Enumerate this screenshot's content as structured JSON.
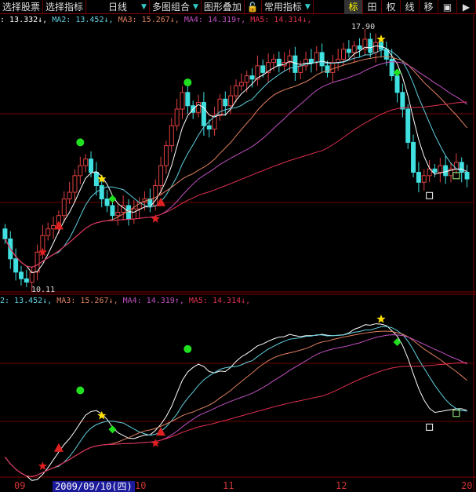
{
  "toolbar": {
    "items": [
      "选择股票",
      "选择指标",
      "日线",
      "多图组合",
      "图形叠加",
      "常用指标"
    ],
    "right_buttons": [
      "标",
      "田",
      "权",
      "线",
      "移",
      "▣",
      "▶"
    ],
    "lock_icon": "lock-icon"
  },
  "upper_legend": {
    "ma1": ": 13.332↓,",
    "ma2": "MA2: 13.452↓,",
    "ma3": "MA3: 15.267↓,",
    "ma4": "MA4: 14.319↑,",
    "ma5": "MA5: 14.314↓,"
  },
  "lower_legend": {
    "ma2": "2: 13.452↓,",
    "ma3": "MA3: 15.267↓,",
    "ma4": "MA4: 14.319↑,",
    "ma5": "MA5: 14.314↓,"
  },
  "price_labels": {
    "high": "17.90",
    "low": "10.11"
  },
  "x_axis": {
    "labels": [
      "09",
      "10",
      "11",
      "12",
      "20"
    ],
    "cursor_date": "2009/09/10(四)"
  },
  "colors": {
    "up": "#e04040",
    "down": "#40e0e0",
    "ma1": "#ffffff",
    "ma2": "#60d0e0",
    "ma3": "#e08060",
    "ma4": "#c050c0",
    "ma5": "#e03050",
    "grid": "#800000"
  },
  "chart_data": {
    "type": "candlestick",
    "closes": [
      11.6,
      11.0,
      10.6,
      10.4,
      10.3,
      10.6,
      11.2,
      11.7,
      11.9,
      12.0,
      12.3,
      12.8,
      13.0,
      13.5,
      13.8,
      14.0,
      13.6,
      13.2,
      12.8,
      12.6,
      12.3,
      12.4,
      12.6,
      12.2,
      12.5,
      12.7,
      12.8,
      12.6,
      13.2,
      13.8,
      14.4,
      15.0,
      15.5,
      16.0,
      15.6,
      15.4,
      15.7,
      15.0,
      14.9,
      15.3,
      15.8,
      15.6,
      15.9,
      16.2,
      16.3,
      16.5,
      16.4,
      16.8,
      16.6,
      16.9,
      17.0,
      16.8,
      16.9,
      17.1,
      16.6,
      16.8,
      17.0,
      16.9,
      17.2,
      16.8,
      16.6,
      16.9,
      17.0,
      17.3,
      17.2,
      17.4,
      17.3,
      17.6,
      17.2,
      17.5,
      17.3,
      17.0,
      16.5,
      16.0,
      15.5,
      14.5,
      13.6,
      13.3,
      13.5,
      13.7,
      13.6,
      13.8,
      13.5,
      13.7,
      13.9,
      13.6,
      13.4
    ],
    "price_range": [
      10.1,
      18.0
    ],
    "lower_range": [
      11.0,
      18.0
    ],
    "ma_periods": [
      5,
      10,
      20,
      30,
      60
    ],
    "markers": [
      {
        "type": "star",
        "color": "#e02020",
        "bar": 7,
        "price": 11.2
      },
      {
        "type": "triangle",
        "color": "#e02020",
        "bar": 10,
        "price": 12.0
      },
      {
        "type": "circle",
        "color": "#20e020",
        "bar": 14,
        "price": 14.5
      },
      {
        "type": "star",
        "color": "#ffe000",
        "bar": 18,
        "price": 13.4
      },
      {
        "type": "diamond",
        "color": "#20e020",
        "bar": 20,
        "price": 12.8
      },
      {
        "type": "star",
        "color": "#e02020",
        "bar": 28,
        "price": 12.2
      },
      {
        "type": "triangle",
        "color": "#e02020",
        "bar": 29,
        "price": 12.7
      },
      {
        "type": "circle",
        "color": "#20e020",
        "bar": 34,
        "price": 16.3
      },
      {
        "type": "star",
        "color": "#ffe000",
        "bar": 70,
        "price": 17.6
      },
      {
        "type": "diamond",
        "color": "#20e020",
        "bar": 73,
        "price": 16.6
      },
      {
        "type": "square",
        "color": "#ffffff",
        "bar": 79,
        "price": 12.9
      },
      {
        "type": "square",
        "color": "#a0ff80",
        "bar": 84,
        "price": 13.5
      }
    ]
  }
}
